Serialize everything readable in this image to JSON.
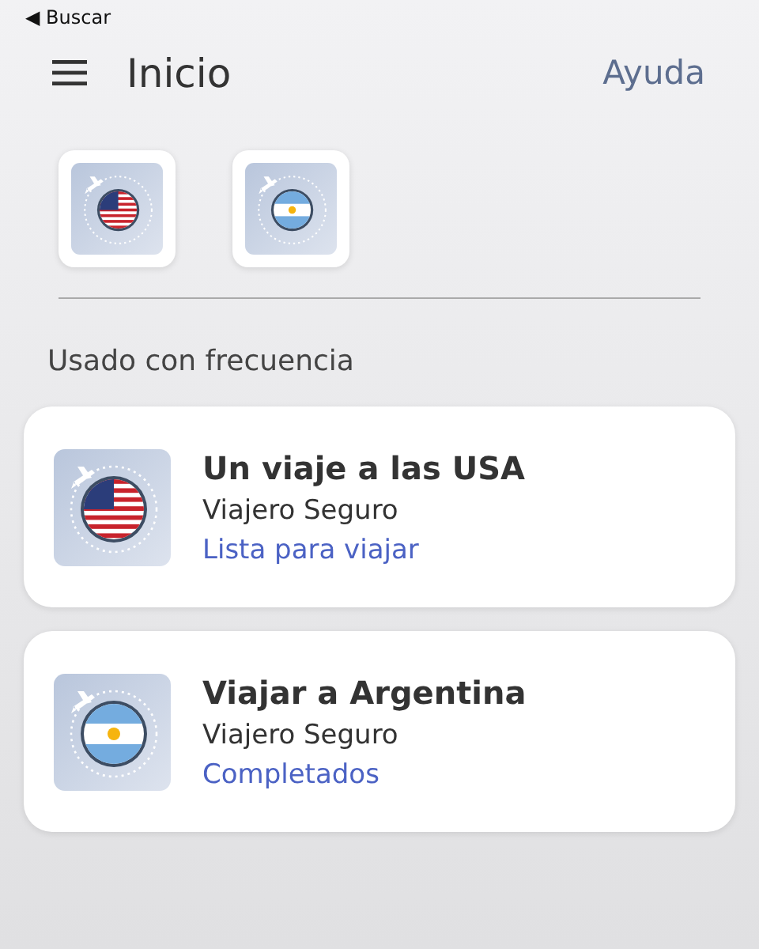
{
  "status_bar": {
    "back_label": "◀ Buscar"
  },
  "header": {
    "title": "Inicio",
    "help": "Ayuda"
  },
  "shortcuts": [
    {
      "kind": "usa"
    },
    {
      "kind": "argentina"
    }
  ],
  "section_title": "Usado con frecuencia",
  "trips": [
    {
      "kind": "usa",
      "title": "Un viaje a las USA",
      "subtitle": "Viajero Seguro",
      "status": "Lista para viajar"
    },
    {
      "kind": "argentina",
      "title": "Viajar a Argentina",
      "subtitle": "Viajero Seguro",
      "status": "Completados"
    }
  ]
}
